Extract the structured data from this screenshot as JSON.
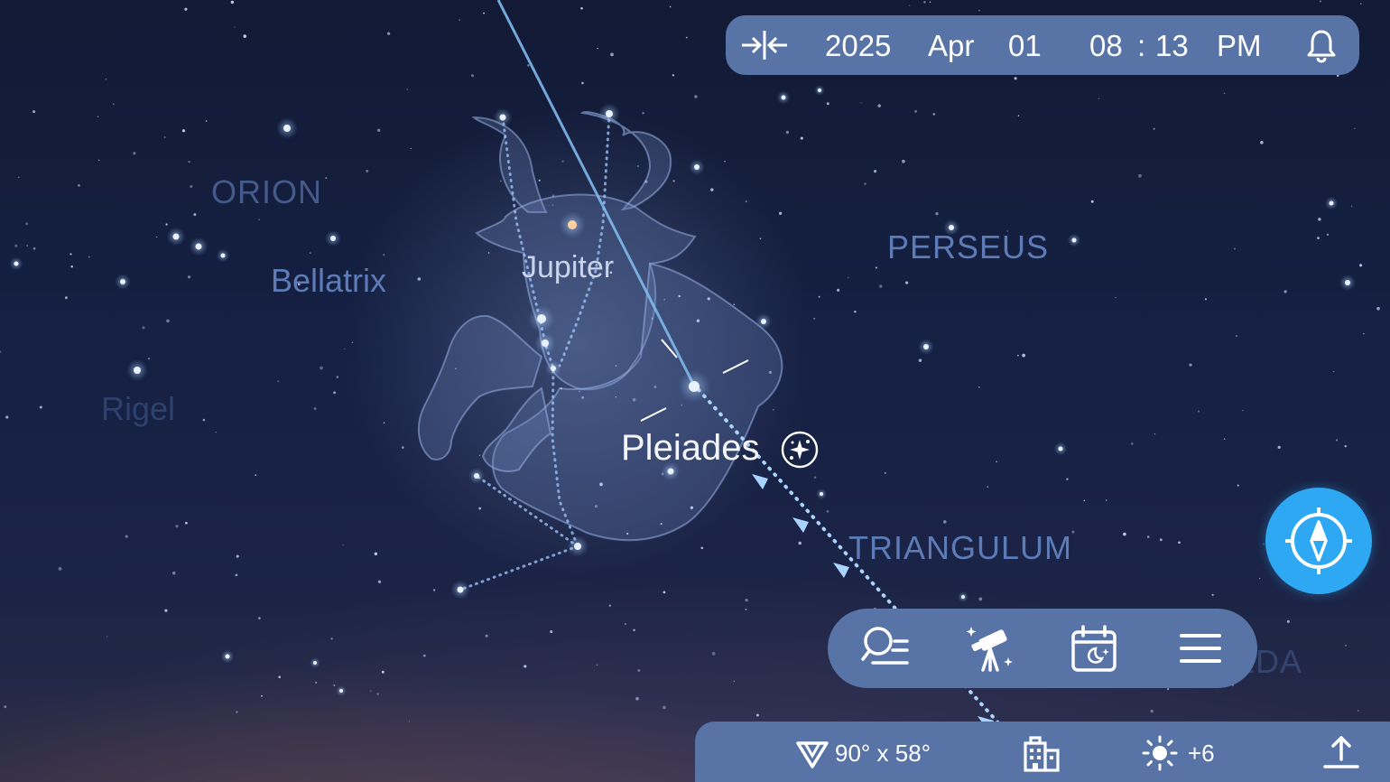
{
  "datetime": {
    "year": "2025",
    "month": "Apr",
    "day": "01",
    "hour": "08",
    "separator": ":",
    "minute": "13",
    "ampm": "PM"
  },
  "sky_labels": {
    "orion": "ORION",
    "bellatrix": "Bellatrix",
    "rigel": "Rigel",
    "jupiter": "Jupiter",
    "perseus": "PERSEUS",
    "pleiades": "Pleiades",
    "triangulum": "TRIANGULUM",
    "andromeda": "ANDROMEDA"
  },
  "status": {
    "field_of_view": "90° x 58°",
    "brightness": "+6"
  },
  "icons": {
    "timebar": [
      "center-collapse-icon",
      "bell-icon"
    ],
    "toolbar": [
      "search-list-icon",
      "telescope-icon",
      "calendar-night-icon",
      "menu-icon"
    ],
    "compass": "compass-icon",
    "statusbar": [
      "field-of-view-icon",
      "buildings-icon",
      "brightness-icon",
      "share-icon"
    ],
    "pleiades": "deep-sky-object-icon"
  },
  "colors": {
    "panel": "#5874a6",
    "compass": "#2ea8f3",
    "sky_top": "#121a35",
    "constellation_label": "#5d7bb6"
  }
}
